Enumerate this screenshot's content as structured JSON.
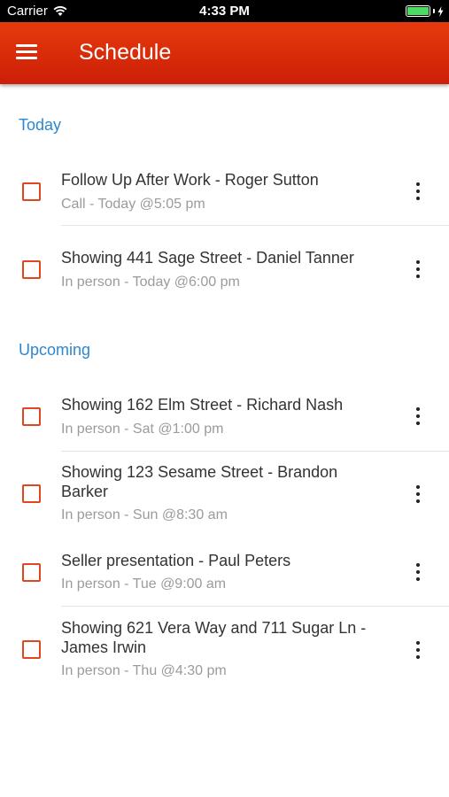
{
  "status_bar": {
    "carrier": "Carrier",
    "time": "4:33 PM",
    "battery_level": 1.0
  },
  "app_bar": {
    "title": "Schedule",
    "menu_icon": "hamburger-menu-icon"
  },
  "sections": {
    "today": {
      "label": "Today",
      "items": [
        {
          "title": "Follow Up After Work - Roger Sutton",
          "subtitle": "Call - Today @5:05 pm"
        },
        {
          "title": "Showing 441 Sage Street - Daniel Tanner",
          "subtitle": "In person - Today @6:00 pm"
        }
      ]
    },
    "upcoming": {
      "label": "Upcoming",
      "items": [
        {
          "title": "Showing 162 Elm Street - Richard Nash",
          "subtitle": "In person - Sat @1:00 pm"
        },
        {
          "title": "Showing 123 Sesame Street - Brandon Barker",
          "subtitle": "In person - Sun @8:30 am"
        },
        {
          "title": "Seller presentation - Paul Peters",
          "subtitle": "In person - Tue @9:00 am"
        },
        {
          "title": "Showing 621 Vera Way and 711 Sugar Ln - James Irwin",
          "subtitle": "In person - Thu @4:30 pm"
        }
      ]
    }
  },
  "colors": {
    "accent": "#e03a12",
    "section_header": "#2b87d1",
    "checkbox": "#e0461f"
  },
  "icons": {
    "checkbox": "checkbox-icon",
    "more": "more-vertical-icon"
  }
}
